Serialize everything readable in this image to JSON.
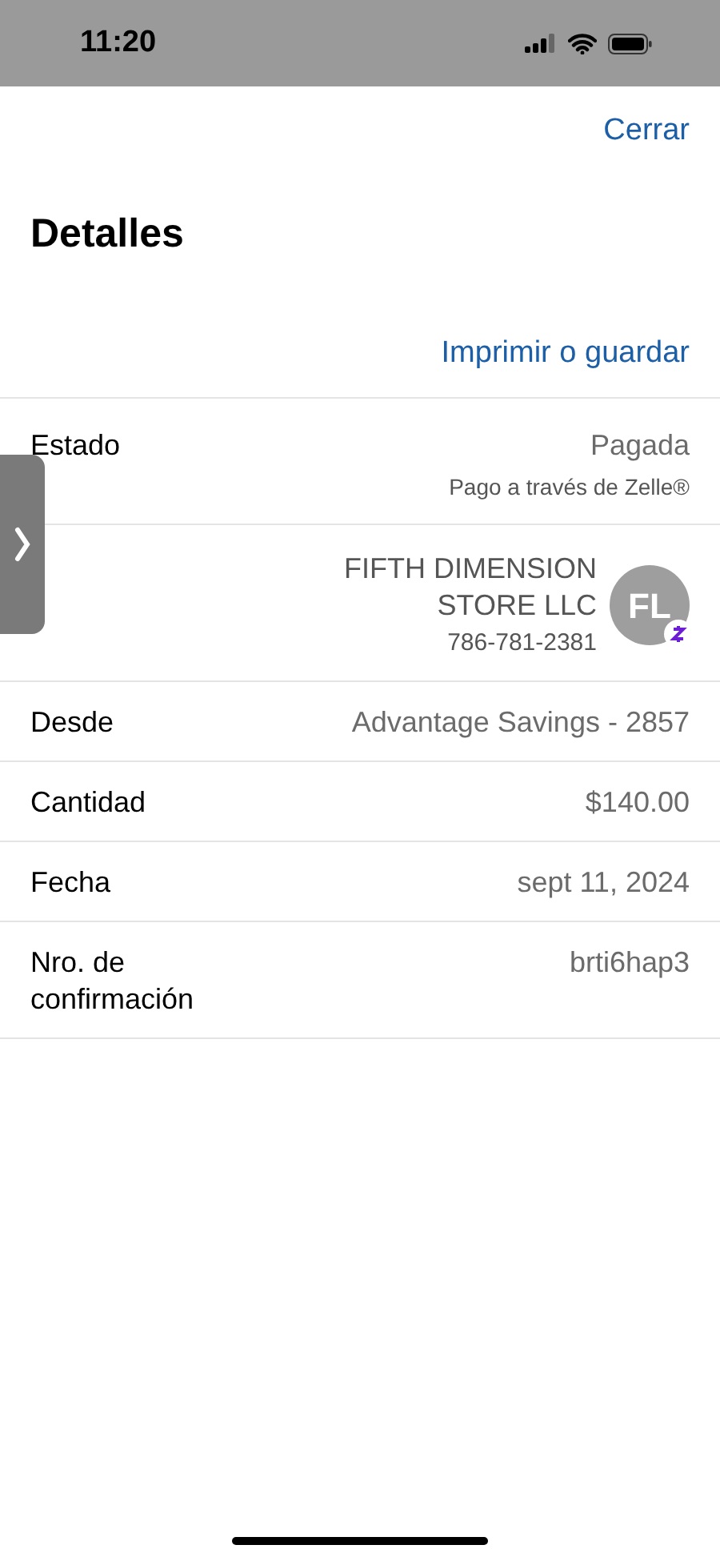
{
  "status_bar": {
    "time": "11:20"
  },
  "close_link": "Cerrar",
  "title": "Detalles",
  "print_link": "Imprimir o guardar",
  "rows": [
    {
      "kind": "status",
      "label": "Estado",
      "value": "Pagada",
      "note": "Pago a través de Zelle®"
    },
    {
      "kind": "recipient",
      "name_lines": [
        "FIFTH DIMENSION",
        "STORE LLC"
      ],
      "phone": "786-781-2381",
      "initials": "FL"
    },
    {
      "kind": "simple",
      "label": "Desde",
      "value": "Advantage Savings - 2857"
    },
    {
      "kind": "simple",
      "label": "Cantidad",
      "value": "$140.00"
    },
    {
      "kind": "simple",
      "label": "Fecha",
      "value": "sept 11, 2024"
    },
    {
      "kind": "simple",
      "label": "Nro. de confirmación",
      "value": "brti6hap3"
    }
  ]
}
